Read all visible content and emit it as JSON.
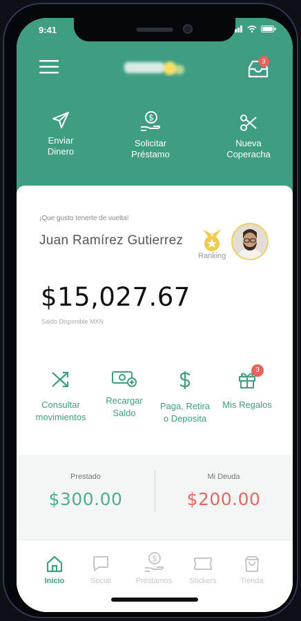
{
  "status_bar": {
    "time": "9:41"
  },
  "header": {
    "inbox_badge": "3"
  },
  "quick_actions": [
    {
      "icon": "send-icon",
      "line1": "Enviar",
      "line2": "Dinero"
    },
    {
      "icon": "loan-request-icon",
      "line1": "Solicitar",
      "line2": "Préstamo"
    },
    {
      "icon": "scissors-icon",
      "line1": "Nueva",
      "line2": "Coperacha"
    }
  ],
  "profile": {
    "greeting": "¡Que gusto tenerte de vuelta!",
    "name": "Juan Ramírez Gutierrez",
    "ranking_label": "Ranking"
  },
  "balance": {
    "amount": "$15,027.67",
    "label": "Saldo Disponible MXN"
  },
  "actions": [
    {
      "icon": "shuffle-icon",
      "line1": "Consultar",
      "line2": "movimientos"
    },
    {
      "icon": "cash-add-icon",
      "line1": "Recargar",
      "line2": "Saldo"
    },
    {
      "icon": "dollar-icon",
      "line1": "Paga, Retira",
      "line2": "o Deposita"
    },
    {
      "icon": "gift-icon",
      "line1": "Mis Regalos",
      "line2": "",
      "badge": "3"
    }
  ],
  "loans": {
    "lent_label": "Prestado",
    "lent_value": "$300.00",
    "debt_label": "Mi Deuda",
    "debt_value": "$200.00"
  },
  "tabs": [
    {
      "label": "Inicio",
      "icon": "home-icon",
      "active": true
    },
    {
      "label": "Social",
      "icon": "chat-icon",
      "active": false
    },
    {
      "label": "Préstamos",
      "icon": "loan-icon",
      "active": false
    },
    {
      "label": "Stickers",
      "icon": "ticket-icon",
      "active": false
    },
    {
      "label": "Tienda",
      "icon": "shopping-bag-icon",
      "active": false
    }
  ],
  "colors": {
    "primary": "#3f9d84",
    "accent_red": "#e8635a",
    "ranking_gold": "#f2c94c"
  }
}
